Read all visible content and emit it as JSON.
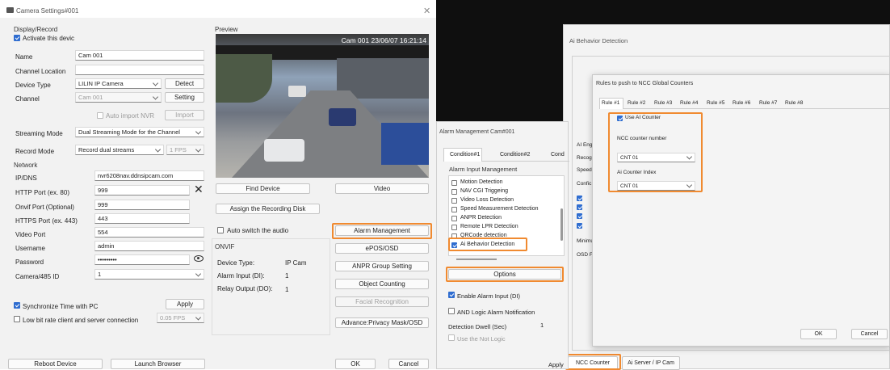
{
  "camera_window": {
    "title": "Camera Settings#001",
    "display_record": {
      "section": "Display/Record",
      "activate_label": "Activate this devic",
      "name_label": "Name",
      "name_value": "Cam 001",
      "channel_location_label": "Channel Location",
      "device_type_label": "Device Type",
      "device_type_value": "LILIN IP Camera",
      "detect_button": "Detect",
      "channel_label": "Channel",
      "channel_value": "Cam 001",
      "setting_button": "Setting",
      "auto_import_label": "Auto import NVR",
      "import_button": "Import",
      "streaming_mode_label": "Streaming Mode",
      "streaming_mode_value": "Dual Streaming Mode for the Channel",
      "record_mode_label": "Record Mode",
      "record_mode_value": "Record dual streams",
      "fps_value": "1 FPS"
    },
    "network": {
      "section": "Network",
      "ipdns_label": "IP/DNS",
      "ipdns_value": "nvr6208nav.ddnsipcam.com",
      "http_label": "HTTP Port (ex. 80)",
      "http_value": "999",
      "onvif_label": "Onvif Port (Optional)",
      "onvif_value": "999",
      "https_label": "HTTPS Port (ex. 443)",
      "https_value": "443",
      "video_label": "Video Port",
      "video_value": "554",
      "username_label": "Username",
      "username_value": "admin",
      "password_label": "Password",
      "password_value": "•••••••••",
      "cam485_label": "Camera/485 ID",
      "cam485_value": "1",
      "sync_label": "Synchronize Time with PC",
      "apply_button": "Apply",
      "lowbit_label": "Low bit rate client and server connection",
      "lowbit_fps": "0.05 FPS"
    },
    "preview": {
      "section": "Preview",
      "overlay": "Cam 001 23/06/07 16:21:14",
      "find_device": "Find Device",
      "video": "Video",
      "assign_disk": "Assign the Recording Disk"
    },
    "auto_switch_label": "Auto switch the audio",
    "onvif": {
      "section": "ONVIF",
      "device_type_label": "Device Type:",
      "device_type_value": "IP Cam",
      "alarm_input_label": "Alarm Input (DI):",
      "alarm_input_value": "1",
      "relay_output_label": "Relay Output (DO):",
      "relay_output_value": "1"
    },
    "right_buttons": [
      "Alarm Management",
      "ePOS/OSD",
      "ANPR Group Setting",
      "Object Counting",
      "Facial Recognition",
      "Advance:Privacy Mask/OSD"
    ],
    "reboot_button": "Reboot Device",
    "launch_button": "Launch Browser",
    "ok_button": "OK",
    "cancel_button": "Cancel"
  },
  "alarm_window": {
    "title": "Alarm Management Cam#001",
    "tabs": [
      "Condition#1",
      "Condition#2",
      "Cond"
    ],
    "section": "Alarm Input Management",
    "items": [
      "Motion Detection",
      "NAV CGI Triggeing",
      "Video Loss Detection",
      "Speed Measurement Detection",
      "ANPR Detection",
      "Remote LPR Detection",
      "QRCode detection",
      "Ai Behavior Detection"
    ],
    "options_button": "Options",
    "enable_label": "Enable Alarm Input (DI)",
    "and_logic_label": "AND Logic Alarm Notification",
    "dwell_label": "Detection Dwell (Sec)",
    "dwell_value": "1",
    "not_logic_label": "Use the Not Logic",
    "apply_button": "Apply"
  },
  "ai_window": {
    "title": "Ai Behavior Detection",
    "side_labels": [
      "AI Eng",
      "Recog",
      "Speed",
      "Confic",
      "Minimu",
      "OSD F"
    ],
    "bottom_tabs": [
      "NCC Counter",
      "Ai Server / IP Cam"
    ]
  },
  "rules_dialog": {
    "title": "Rules to push to NCC Global Counters",
    "tabs": [
      "Rule #1",
      "Rule #2",
      "Rule #3",
      "Rule #4",
      "Rule #5",
      "Rule #6",
      "Rule #7",
      "Rule #8"
    ],
    "use_ai_counter": "Use AI Counter",
    "ncc_counter_label": "NCC counter number",
    "ncc_counter_value": "CNT 01",
    "ai_index_label": "Ai Counter Index",
    "ai_index_value": "CNT 01",
    "ok_button": "OK",
    "cancel_button": "Cancel"
  },
  "colors": {
    "highlight": "#f08a30",
    "check_blue": "#2f6dd0"
  }
}
